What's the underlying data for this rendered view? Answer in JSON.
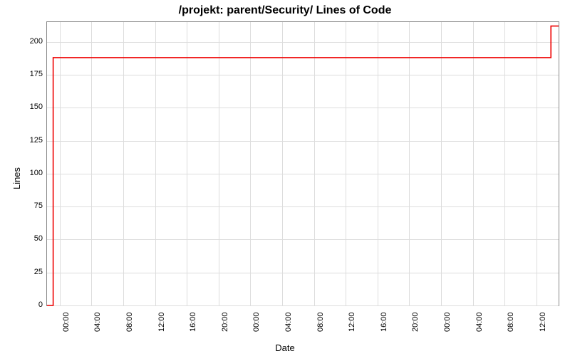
{
  "chart_data": {
    "type": "line",
    "title": "/projekt: parent/Security/ Lines of Code",
    "xlabel": "Date",
    "ylabel": "Lines",
    "ylim": [
      0,
      215
    ],
    "y_ticks": [
      0,
      25,
      50,
      75,
      100,
      125,
      150,
      175,
      200
    ],
    "x_ticks": [
      "00:00",
      "04:00",
      "08:00",
      "12:00",
      "16:00",
      "20:00",
      "00:00",
      "04:00",
      "08:00",
      "12:00",
      "16:00",
      "20:00",
      "00:00",
      "04:00",
      "08:00",
      "12:00"
    ],
    "series": [
      {
        "name": "Lines of Code",
        "color": "#ee0000",
        "x": [
          0.0,
          0.012,
          0.012,
          0.985,
          0.985,
          1.0
        ],
        "y": [
          0,
          0,
          188,
          188,
          212,
          212
        ]
      }
    ],
    "grid": true
  }
}
